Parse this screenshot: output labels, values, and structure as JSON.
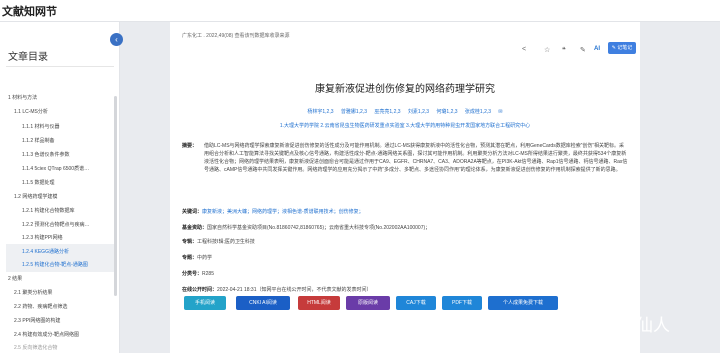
{
  "app": {
    "brand": "文献知网节"
  },
  "sidebar": {
    "title": "文章目录",
    "collapse_icon": "‹",
    "items": [
      {
        "label": "1 材料与方法",
        "style": "normal"
      },
      {
        "label": "1.1 LC-MS分析",
        "style": "normal"
      },
      {
        "label": "1.1.1 材料与仪器",
        "style": "normal"
      },
      {
        "label": "1.1.2 样品制备",
        "style": "normal"
      },
      {
        "label": "1.1.3 色谱仪条件参数",
        "style": "normal"
      },
      {
        "label": "1.1.4 5ciex QTrap 6500质谱…",
        "style": "normal"
      },
      {
        "label": "1.1.5 数据处理",
        "style": "normal"
      },
      {
        "label": "1.2 网络药理学建模",
        "style": "normal"
      },
      {
        "label": "1.2.1 构建化合物数据库",
        "style": "normal"
      },
      {
        "label": "1.2.2 预测化合物靶点与疾病…",
        "style": "normal"
      },
      {
        "label": "1.2.3 构建PPI网络",
        "style": "normal"
      },
      {
        "label": "1.2.4 KEGG通路分析",
        "style": "active"
      },
      {
        "label": "1.2.5 构建化合物-靶点-通路图",
        "style": "active"
      },
      {
        "label": "2 结果",
        "style": "normal"
      },
      {
        "label": "2.1 聚类分析结果",
        "style": "normal"
      },
      {
        "label": "2.2 药物、疾病靶点筛选",
        "style": "normal"
      },
      {
        "label": "2.3 PPI网络图的构建",
        "style": "normal"
      },
      {
        "label": "2.4 构建有效成分-靶点网络图",
        "style": "normal"
      },
      {
        "label": "2.5 反向筛选化合物",
        "style": "dim"
      }
    ]
  },
  "article": {
    "meta": "广东化工 . 2022,49(08)  查看该刊数据库收录来源",
    "title": "康复新液促进创伤修复的网络药理学研究",
    "authors": "杨林宇1,2,3  曾雅娜1,2,3  巫亮亮1,2,3  刘素1,2,3  何璐1,2,3  张成桂1,2,3 ✉",
    "affiliations": "1.大理大学药学院   2.云南省昆虫生物医药研发重点实验室   3.大理大学药用特种昆虫开发国家地方联合工程研究中心",
    "abstract_label": "摘要：",
    "abstract": "借助LC-MS与网络药理学探索康复新液促进创伤修复的活性成分及可能作用机制。通过LC-MS获得康复新液中的活性化合物，预测其潜在靶点，利用GeneCards数据库检索“创伤”相关靶标。采用组合分析和人工智能算法寻找关键靶点及核心信号通路，构建活性成分-靶点-通路网络关系图，探讨其可能作用机制。利用聚类分析方法对LC-MS所得结果进行聚类，最终共获得534个康复新液活性化合物；网络药理学结果表明，康复新液促进创面愈合可能是通过作用于CA9、EGFR、CHRNA7、CA3、ADORA2A等靶点，在PI3K-Akt信号通路、Rap1信号通路、钙信号通路、Ras信号通路、cAMP信号通路中共同发挥关键作用。网络药理学的应用充分揭示了中药“多成分、多靶点、多途径协同作用”的理论体系，为康复新液促进创伤修复的作用机制探索提供了新的思路。",
    "keywords_label": "关键词：",
    "keywords": "康复新液；美洲大蠊；网络药理学；液相色谱-质谱联用技术；创伤修复；",
    "fund_label": "基金资助：",
    "fund": "国家自然科学基金资助项目(No.81860742,81860765)；云南省重大科技专项(No.202002AA100007)；",
    "topic_label": "专辑：",
    "topic": "工程科技Ⅰ辑;医药卫生科技",
    "subject_label": "专题：",
    "subject": "中药学",
    "class_label": "分类号：",
    "class": "R285",
    "pubdate_label": "在线公开时间：",
    "pubdate": "2022-04-21 18:31（知网平台在线公开时间，不代表文献的发表时间）"
  },
  "toolbar": {
    "share_icon": "share-icon",
    "star_icon": "star-icon",
    "quote_icon": "quote-icon",
    "note_icon": "note-icon",
    "ai_label": "AI",
    "cite_label": "✎ 记笔记"
  },
  "downloads": [
    {
      "label": "手机阅读",
      "color": "#23a3c9"
    },
    {
      "label": "CNKI AI阅读",
      "color": "#1b5fc6"
    },
    {
      "label": "HTML阅读",
      "color": "#c63b3b"
    },
    {
      "label": "原版阅读",
      "color": "#6a3ca8"
    },
    {
      "label": "CAJ下载",
      "color": "#1f86d8"
    },
    {
      "label": "PDF下载",
      "color": "#1f86d8"
    },
    {
      "label": "个人成果免费下载",
      "color": "#1e6fcf"
    }
  ],
  "watermark": "知乎 @胖仙人",
  "colors": {
    "accent": "#1e6fcf",
    "cite_button": "#3f7fe0"
  }
}
